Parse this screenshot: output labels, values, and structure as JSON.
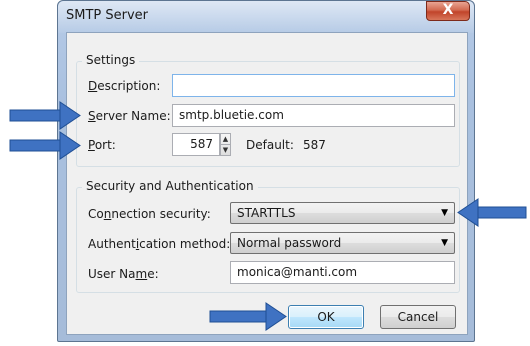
{
  "window": {
    "title": "SMTP Server",
    "close_glyph": "X"
  },
  "settings": {
    "legend": "Settings",
    "description": {
      "label_prefix": "",
      "label_ul": "D",
      "label_rest": "escription:",
      "value": ""
    },
    "server_name": {
      "label_ul": "S",
      "label_rest": "erver Name:",
      "value": "smtp.bluetie.com"
    },
    "port": {
      "label_ul": "P",
      "label_rest": "ort:",
      "value": "587",
      "default_label": "Default:",
      "default_value": "587"
    }
  },
  "security": {
    "legend": "Security and Authentication",
    "connection": {
      "label_a": "Co",
      "label_ul": "n",
      "label_b": "nection security:",
      "value": "STARTTLS"
    },
    "auth": {
      "label_a": "Authent",
      "label_ul": "i",
      "label_b": "cation method:",
      "value": "Normal password"
    },
    "user": {
      "label_a": "User Na",
      "label_ul": "m",
      "label_b": "e:",
      "value": "monica@manti.com"
    }
  },
  "buttons": {
    "ok": "OK",
    "cancel": "Cancel"
  },
  "colors": {
    "annotation_arrow": "#3f72c2",
    "title_bar": "#b6cbe7",
    "close_button": "#c1442a"
  },
  "icons": {
    "close": "close-icon",
    "spin_up": "spin-up-icon",
    "spin_down": "spin-down-icon",
    "dropdown": "chevron-down-icon",
    "annotation": "arrow-right-icon"
  }
}
